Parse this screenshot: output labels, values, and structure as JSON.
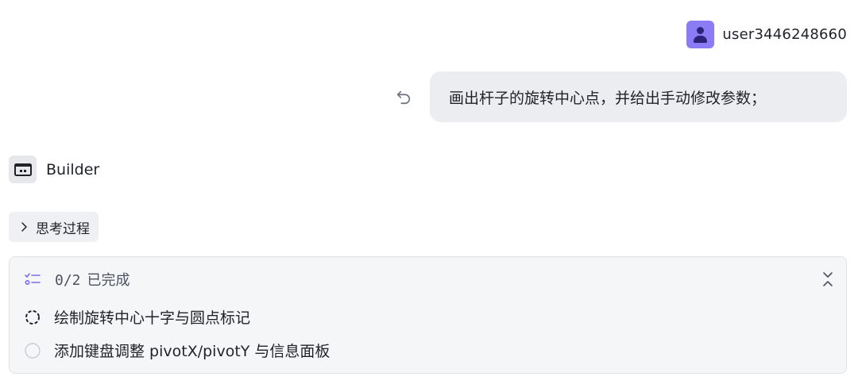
{
  "user": {
    "name": "user3446248660"
  },
  "message": {
    "text": "画出杆子的旋转中心点，并给出手动修改参数；"
  },
  "assistant": {
    "name": "Builder"
  },
  "thinking": {
    "label": "思考过程"
  },
  "tasks": {
    "count_text": "0/2",
    "status_text": "已完成",
    "items": [
      {
        "label": "绘制旋转中心十字与圆点标记",
        "state": "in-progress"
      },
      {
        "label": "添加键盘调整 pivotX/pivotY 与信息面板",
        "state": "pending"
      }
    ]
  },
  "colors": {
    "avatar": "#8b7cf6",
    "bubble": "#ebedf0",
    "accent": "#7c6cf0"
  }
}
